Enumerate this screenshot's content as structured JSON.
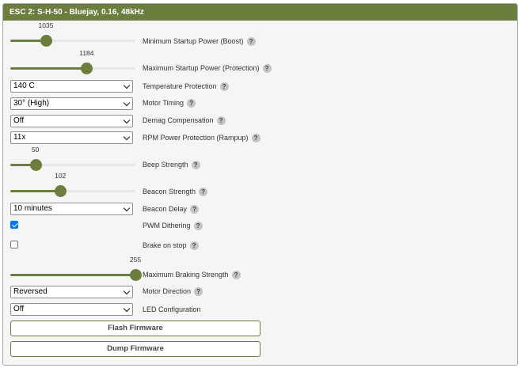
{
  "panel": {
    "title": "ESC 2: S-H-50 - Bluejay, 0.16, 48kHz"
  },
  "help_glyph": "?",
  "settings": {
    "min_startup": {
      "label": "Minimum Startup Power (Boost)",
      "value": "1035",
      "fraction": 0.285
    },
    "max_startup": {
      "label": "Maximum Startup Power (Protection)",
      "value": "1184",
      "fraction": 0.61
    },
    "temp_protection": {
      "label": "Temperature Protection",
      "selected": "140 C"
    },
    "motor_timing": {
      "label": "Motor Timing",
      "selected": "30° (High)"
    },
    "demag": {
      "label": "Demag Compensation",
      "selected": "Off"
    },
    "rpm_protection": {
      "label": "RPM Power Protection (Rampup)",
      "selected": "11x"
    },
    "beep_strength": {
      "label": "Beep Strength",
      "value": "50",
      "fraction": 0.2
    },
    "beacon_strength": {
      "label": "Beacon Strength",
      "value": "102",
      "fraction": 0.4
    },
    "beacon_delay": {
      "label": "Beacon Delay",
      "selected": "10 minutes"
    },
    "pwm_dithering": {
      "label": "PWM Dithering",
      "checked": true
    },
    "brake_on_stop": {
      "label": "Brake on stop",
      "checked": false
    },
    "max_braking": {
      "label": "Maximum Braking Strength",
      "value": "255",
      "fraction": 1.0
    },
    "motor_direction": {
      "label": "Motor Direction",
      "selected": "Reversed"
    },
    "led_config": {
      "label": "LED Configuration",
      "selected": "Off"
    }
  },
  "buttons": {
    "flash": "Flash Firmware",
    "dump": "Dump Firmware"
  },
  "colors": {
    "accent": "#6c7e3e",
    "header_text": "#ffffff",
    "checkbox": "#0075ff"
  }
}
